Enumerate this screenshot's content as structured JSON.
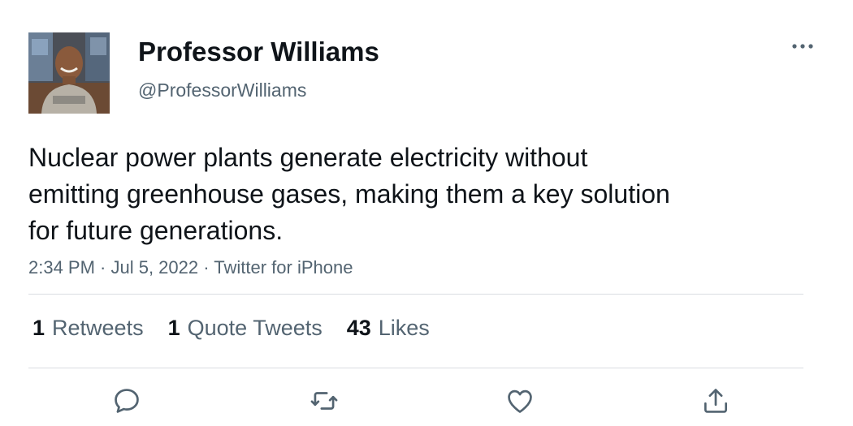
{
  "tweet": {
    "author_name": "Professor Williams",
    "author_handle": "@ProfessorWilliams",
    "text": "Nuclear power plants generate electricity without\nemitting greenhouse gases, making them a key solution\nfor future generations.",
    "meta": "2:34 PM · Jul 5, 2022 · Twitter for iPhone"
  },
  "stats": [
    {
      "count": "1",
      "label": "Retweets"
    },
    {
      "count": "1",
      "label": "Quote Tweets"
    },
    {
      "count": "43",
      "label": "Likes"
    }
  ],
  "icons": {
    "more": "more-horizontal-icon",
    "reply": "reply-icon",
    "retweet": "retweet-icon",
    "like": "heart-icon",
    "share": "share-icon"
  },
  "colors": {
    "text_primary": "#0f1419",
    "text_secondary": "#536471",
    "divider": "#d9dde1"
  }
}
